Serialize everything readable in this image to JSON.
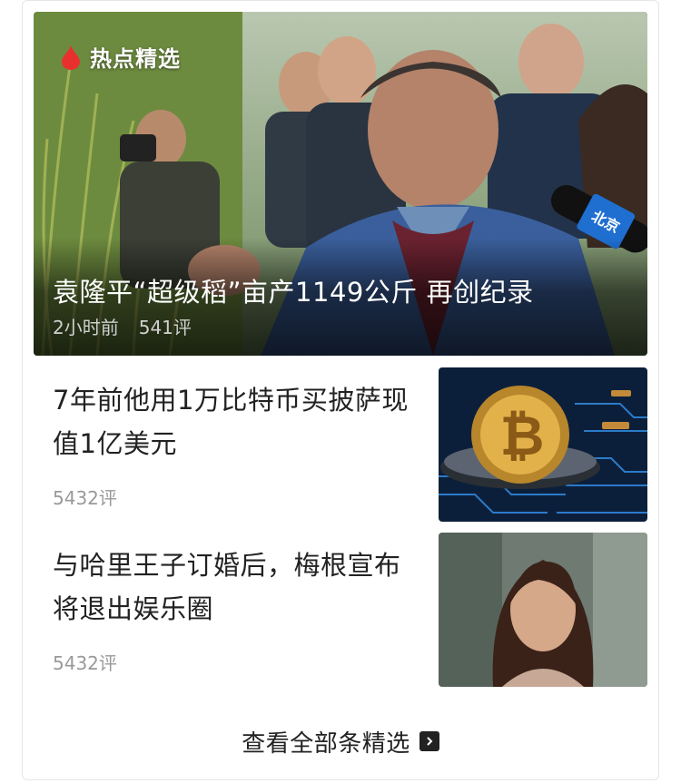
{
  "hero": {
    "badge_label": "热点精选",
    "title": "袁隆平“超级稻”亩产1149公斤 再创纪录",
    "time": "2小时前",
    "comments": "541评",
    "mic_label": "北京",
    "image_desc_icon": "photo"
  },
  "items": [
    {
      "title": "7年前他用1万比特币买披萨现值1亿美元",
      "comments": "5432评"
    },
    {
      "title": "与哈里王子订婚后，梅根宣布将退出娱乐圈",
      "comments": "5432评"
    }
  ],
  "footer": {
    "label": "查看全部条精选",
    "icon": "chevron-right-icon"
  },
  "colors": {
    "accent": "#e8312e",
    "text": "#222222",
    "muted": "#999999"
  }
}
